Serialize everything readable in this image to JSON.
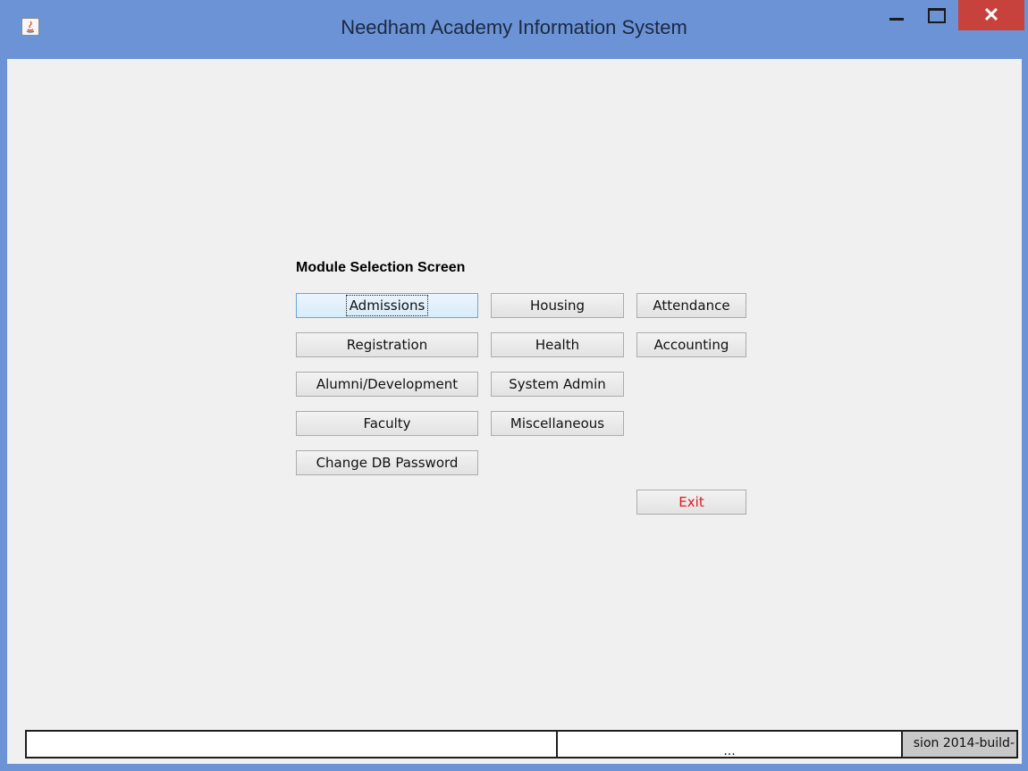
{
  "window": {
    "title": "Needham Academy Information System",
    "controls": {
      "minimize_icon": "minimize-icon",
      "maximize_icon": "maximize-icon",
      "close_label": "✕"
    },
    "accent_color": "#6b93d6",
    "close_color": "#c7423d"
  },
  "main": {
    "heading": "Module Selection Screen",
    "buttons": {
      "admissions": "Admissions",
      "housing": "Housing",
      "attendance": "Attendance",
      "registration": "Registration",
      "health": "Health",
      "accounting": "Accounting",
      "alumni": "Alumni/Development",
      "system_admin": "System Admin",
      "faculty": "Faculty",
      "miscellaneous": "Miscellaneous",
      "change_db_password": "Change DB Password",
      "exit": "Exit"
    },
    "exit_color": "#e0171f"
  },
  "status_bar": {
    "segment1": "",
    "segment2": "...",
    "segment3": "sion 2014-build-"
  }
}
